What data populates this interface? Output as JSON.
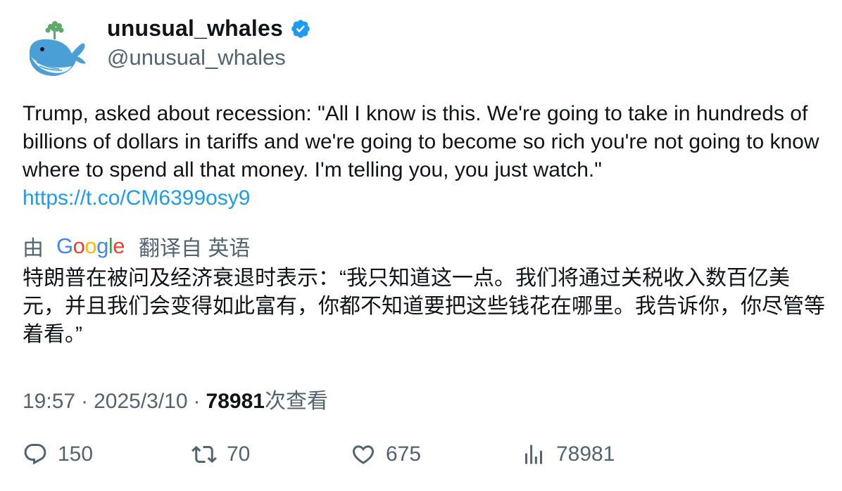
{
  "author": {
    "display_name": "unusual_whales",
    "handle": "@unusual_whales",
    "verified": true,
    "avatar_icon": "whale-avatar-icon",
    "verified_color": "#1d9bf0"
  },
  "tweet": {
    "text": "Trump, asked about recession: \"All I know is this. We're going to take in hundreds of billions of dollars in tariffs and we're going to become so rich you're not going to know where to spend all that money. I'm telling you, you just watch.\" ",
    "link": "https://t.co/CM6399osy9",
    "link_color": "#1d9bf0"
  },
  "translation": {
    "prefix": "由",
    "provider_letters": [
      "G",
      "o",
      "o",
      "g",
      "l",
      "e"
    ],
    "suffix": "翻译自 英语",
    "text": "特朗普在被问及经济衰退时表示：“我只知道这一点。我们将通过关税收入数百亿美元，并且我们会变得如此富有，你都不知道要把这些钱花在哪里。我告诉你，你尽管等着看。”"
  },
  "meta": {
    "time": "19:57",
    "separator": "·",
    "date": "2025/3/10",
    "views_count": "78981",
    "views_label": "次查看"
  },
  "actions": {
    "replies": "150",
    "retweets": "70",
    "likes": "675",
    "views": "78981"
  }
}
